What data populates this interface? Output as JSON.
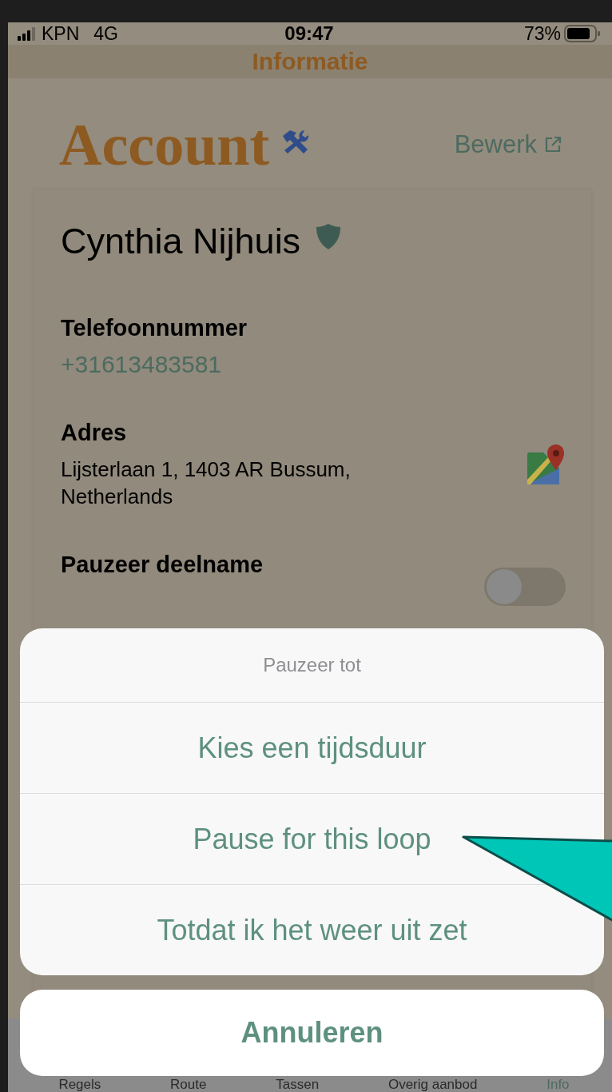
{
  "status_bar": {
    "carrier": "KPN",
    "network": "4G",
    "time": "09:47",
    "battery": "73%"
  },
  "nav_title": "Informatie",
  "header": {
    "title": "Account",
    "edit_link": "Bewerk"
  },
  "profile": {
    "name": "Cynthia Nijhuis",
    "fields": [
      {
        "kind": "phone",
        "label": "Telefoonnummer",
        "value": "+31613483581"
      },
      {
        "kind": "address",
        "label": "Adres",
        "value": "Lijsterlaan 1, 1403 AR Bussum, Netherlands"
      },
      {
        "kind": "toggle",
        "label": "Pauzeer deelname",
        "on": false
      }
    ]
  },
  "action_sheet": {
    "title": "Pauzeer tot",
    "options": [
      "Kies een tijdsduur",
      "Pause for this loop",
      "Totdat ik het weer uit zet"
    ],
    "cancel": "Annuleren"
  },
  "tab_bar": [
    {
      "label": "Regels",
      "selected": false
    },
    {
      "label": "Route",
      "selected": false
    },
    {
      "label": "Tassen",
      "selected": false
    },
    {
      "label": "Overig aanbod",
      "selected": false
    },
    {
      "label": "Info",
      "selected": true
    }
  ]
}
